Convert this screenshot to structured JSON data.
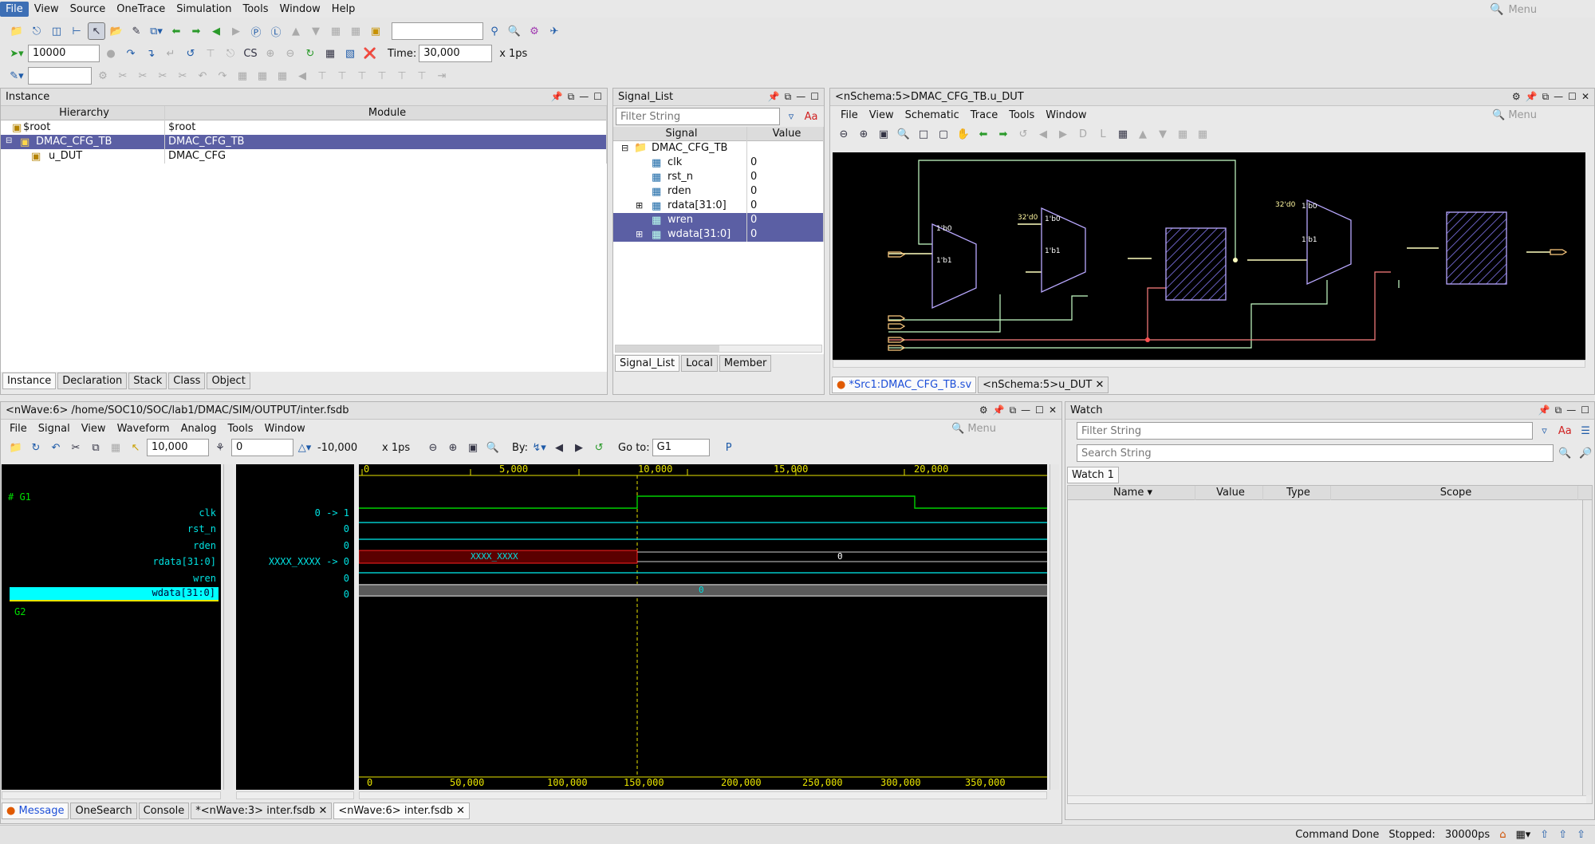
{
  "menubar": {
    "items": [
      "File",
      "View",
      "Source",
      "OneTrace",
      "Simulation",
      "Tools",
      "Window",
      "Help"
    ],
    "menu_search_placeholder": "Menu"
  },
  "toolbar2": {
    "goto_value": "10000",
    "time_label": "Time:",
    "time_value": "30,000",
    "time_unit": "x 1ps"
  },
  "instance": {
    "title": "Instance",
    "columns": [
      "Hierarchy",
      "Module"
    ],
    "rows": [
      {
        "name": "$root",
        "module": "$root"
      },
      {
        "name": "DMAC_CFG_TB",
        "module": "DMAC_CFG_TB"
      },
      {
        "name": "u_DUT",
        "module": "DMAC_CFG"
      }
    ],
    "tabs": [
      "Instance",
      "Declaration",
      "Stack",
      "Class",
      "Object"
    ]
  },
  "signal_list": {
    "title": "Signal_List",
    "filter_placeholder": "Filter String",
    "columns": [
      "Signal",
      "Value"
    ],
    "scope": "DMAC_CFG_TB",
    "signals": [
      {
        "name": "clk",
        "value": "0"
      },
      {
        "name": "rst_n",
        "value": "0"
      },
      {
        "name": "rden",
        "value": "0"
      },
      {
        "name": "rdata[31:0]",
        "value": "0"
      },
      {
        "name": "wren",
        "value": "0"
      },
      {
        "name": "wdata[31:0]",
        "value": "0"
      }
    ],
    "tabs": [
      "Signal_List",
      "Local",
      "Member"
    ]
  },
  "schema": {
    "title": "<nSchema:5>DMAC_CFG_TB.u_DUT",
    "menu": [
      "File",
      "View",
      "Schematic",
      "Trace",
      "Tools",
      "Window"
    ],
    "menu_search_placeholder": "Menu",
    "mux_labels": [
      "1'b0",
      "1'b1",
      "32'd0",
      "1'b0",
      "1'b1",
      "32'd0",
      "1'b0",
      "1'b1"
    ],
    "tabs": [
      "*Src1:DMAC_CFG_TB.sv",
      "<nSchema:5>u_DUT"
    ]
  },
  "wave": {
    "title": "<nWave:6> /home/SOC10/SOC/lab1/DMAC/SIM/OUTPUT/inter.fsdb",
    "menu": [
      "File",
      "Signal",
      "View",
      "Waveform",
      "Analog",
      "Tools",
      "Window"
    ],
    "menu_search_placeholder": "Menu",
    "cursor_value": "10,000",
    "marker_value": "0",
    "delta_value": "-10,000",
    "unit": "x 1ps",
    "by_label": "By:",
    "goto_label": "Go to:",
    "goto_value": "G1",
    "groups": [
      "G1",
      "G2"
    ],
    "signals": [
      {
        "name": "clk",
        "value": "0 -> 1"
      },
      {
        "name": "rst_n",
        "value": "0"
      },
      {
        "name": "rden",
        "value": "0"
      },
      {
        "name": "rdata[31:0]",
        "value": "XXXX_XXXX -> 0"
      },
      {
        "name": "wren",
        "value": "0"
      },
      {
        "name": "wdata[31:0]",
        "value": "0"
      }
    ],
    "ruler_top": [
      "0",
      "5,000",
      "10,000",
      "15,000",
      "20,000"
    ],
    "ruler_bottom": [
      "0",
      "50,000",
      "100,000",
      "150,000",
      "200,000",
      "250,000",
      "300,000",
      "350,000"
    ],
    "rdata_x_label": "XXXX_XXXX",
    "rdata_zero_label": "0",
    "wdata_label": "0"
  },
  "watch": {
    "title": "Watch",
    "filter_placeholder": "Filter String",
    "search_placeholder": "Search String",
    "tab": "Watch 1",
    "columns": [
      "Name",
      "Value",
      "Type",
      "Scope"
    ]
  },
  "bottom_tabs": [
    "Message",
    "OneSearch",
    "Console",
    "*<nWave:3> inter.fsdb",
    "<nWave:6> inter.fsdb"
  ],
  "status": {
    "command": "Command Done",
    "stopped_label": "Stopped:",
    "stopped_value": "30000ps"
  },
  "colors": {
    "selection": "#5b5fa4",
    "wave_green": "#00d000",
    "wave_cyan": "#00c8c8",
    "ruler": "#e8e400"
  }
}
